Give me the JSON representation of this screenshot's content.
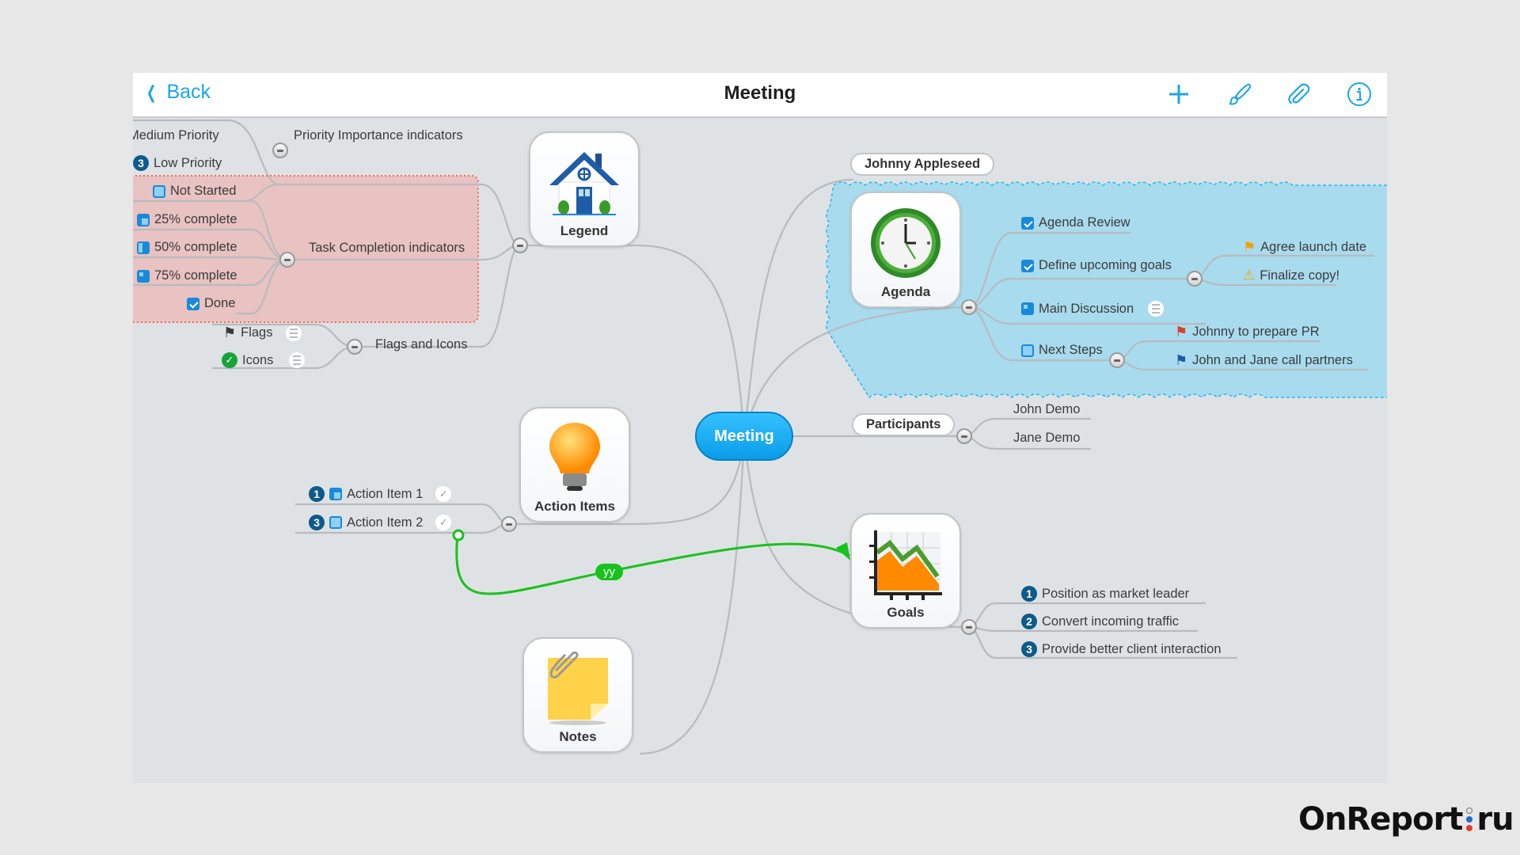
{
  "header": {
    "back_label": "Back",
    "title": "Meeting",
    "icons": [
      "plus-icon",
      "brush-icon",
      "paperclip-icon",
      "info-icon"
    ]
  },
  "central": {
    "label": "Meeting",
    "color": "#0a9ce8"
  },
  "legend": {
    "label": "Legend",
    "priority": {
      "label": "Priority Importance indicators",
      "items": [
        {
          "label": "Medium Priority"
        },
        {
          "label": "Low Priority",
          "badge": "3"
        }
      ]
    },
    "task_completion": {
      "label": "Task Completion indicators",
      "items": [
        {
          "label": "Not Started"
        },
        {
          "label": "25% complete"
        },
        {
          "label": "50% complete"
        },
        {
          "label": "75% complete"
        },
        {
          "label": "Done"
        }
      ],
      "highlight_color": "#e9c2c2"
    },
    "flags_icons": {
      "label": "Flags and Icons",
      "items": [
        {
          "label": "Flags"
        },
        {
          "label": "Icons"
        }
      ]
    }
  },
  "agenda": {
    "owner": "Johnny Appleseed",
    "label": "Agenda",
    "cloud_color": "#a9dbee",
    "items": [
      {
        "label": "Agenda Review",
        "status": "done"
      },
      {
        "label": "Define upcoming goals",
        "status": "done",
        "children": [
          {
            "label": "Agree launch date",
            "icon": "orange-flag"
          },
          {
            "label": "Finalize copy!",
            "icon": "warning"
          }
        ]
      },
      {
        "label": "Main Discussion",
        "status": "75%"
      },
      {
        "label": "Next Steps",
        "status": "not-started",
        "children": [
          {
            "label": "Johnny to prepare PR",
            "icon": "red-flag"
          },
          {
            "label": "John and Jane call partners",
            "icon": "blue-flag"
          }
        ]
      }
    ]
  },
  "participants": {
    "label": "Participants",
    "items": [
      "John Demo",
      "Jane Demo"
    ]
  },
  "action_items": {
    "label": "Action Items",
    "items": [
      {
        "label": "Action Item 1",
        "priority": "1",
        "status": "25%"
      },
      {
        "label": "Action Item 2",
        "priority": "3",
        "status": "not-started"
      }
    ]
  },
  "relationship": {
    "label": "yy",
    "color": "#18c21c"
  },
  "goals": {
    "label": "Goals",
    "items": [
      {
        "n": "1",
        "label": "Position as market leader"
      },
      {
        "n": "2",
        "label": "Convert incoming traffic"
      },
      {
        "n": "3",
        "label": "Provide better client interaction"
      }
    ]
  },
  "notes": {
    "label": "Notes"
  },
  "watermark": {
    "left": "OnReport",
    "right": "ru"
  }
}
